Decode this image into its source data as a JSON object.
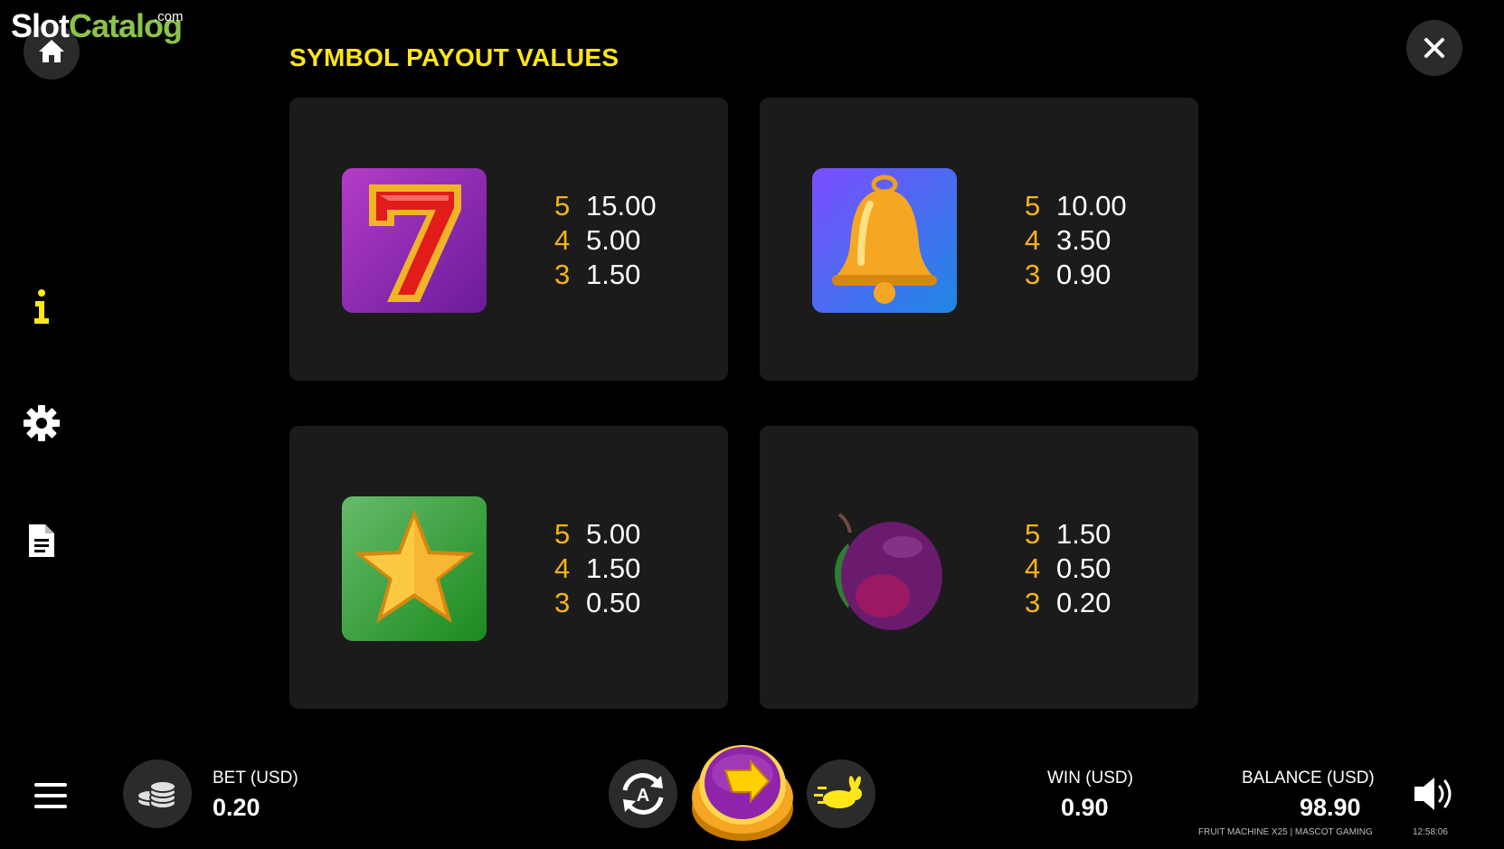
{
  "brand": {
    "slot": "Slot",
    "catalog": "Catalog",
    "com": ".com"
  },
  "title": "SYMBOL PAYOUT VALUES",
  "symbols": [
    {
      "name": "seven",
      "pays": [
        {
          "count": "5",
          "value": "15.00"
        },
        {
          "count": "4",
          "value": "5.00"
        },
        {
          "count": "3",
          "value": "1.50"
        }
      ]
    },
    {
      "name": "bell",
      "pays": [
        {
          "count": "5",
          "value": "10.00"
        },
        {
          "count": "4",
          "value": "3.50"
        },
        {
          "count": "3",
          "value": "0.90"
        }
      ]
    },
    {
      "name": "star",
      "pays": [
        {
          "count": "5",
          "value": "5.00"
        },
        {
          "count": "4",
          "value": "1.50"
        },
        {
          "count": "3",
          "value": "0.50"
        }
      ]
    },
    {
      "name": "plum",
      "pays": [
        {
          "count": "5",
          "value": "1.50"
        },
        {
          "count": "4",
          "value": "0.50"
        },
        {
          "count": "3",
          "value": "0.20"
        }
      ]
    }
  ],
  "footer": {
    "bet_label": "BET (USD)",
    "bet_value": "0.20",
    "win_label": "WIN (USD)",
    "win_value": "0.90",
    "balance_label": "BALANCE (USD)",
    "balance_value": "98.90",
    "game_credit": "FRUIT MACHINE X25 | MASCOT GAMING",
    "clock": "12:58:06"
  },
  "icons": [
    "home-icon",
    "close-icon",
    "info-icon",
    "gear-icon",
    "document-icon",
    "menu-icon",
    "coins-icon",
    "autoplay-icon",
    "spin-icon",
    "turbo-rabbit-icon",
    "speaker-icon"
  ],
  "colors": {
    "accent_yellow": "#ffe619",
    "count_orange": "#f6b21b",
    "card_bg": "#1b1b1b",
    "logo_green": "#8bc34a"
  }
}
